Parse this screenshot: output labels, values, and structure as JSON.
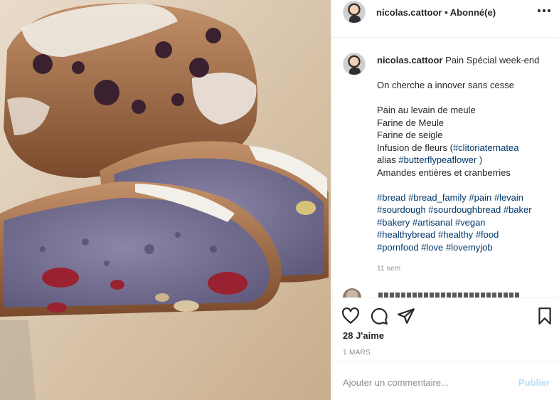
{
  "header": {
    "username": "nicolas.cattoor",
    "separator": " • ",
    "follow_status": "Abonné(e)"
  },
  "caption": {
    "username": "nicolas.cattoor",
    "title": "Pain Spécial week-end",
    "line1": "On cherche a innover sans cesse",
    "line2": "Pain au levain de meule",
    "line3": "Farine de Meule",
    "line4": "Farine de seigle",
    "line5_prefix": "Infusion de fleurs (",
    "line5_tag": "#clitoriaternatea",
    "line6_prefix": "alias ",
    "line6_tag": "#butterflypeaflower",
    "line6_suffix": " )",
    "line7": "Amandes entières et cranberries",
    "hashtags": [
      [
        "#bread",
        "#bread_family",
        "#pain",
        "#levain"
      ],
      [
        "#sourdough",
        "#sourdoughbread",
        "#baker"
      ],
      [
        "#bakery",
        "#artisanal",
        "#vegan"
      ],
      [
        "#healthybread",
        "#healthy",
        "#food"
      ],
      [
        "#pornfood",
        "#love",
        "#lovemyjob"
      ]
    ],
    "time_ago": "11 sem"
  },
  "actions": {
    "icons": [
      "heart-icon",
      "comment-icon",
      "share-icon",
      "bookmark-icon"
    ],
    "likes": "28 J'aime",
    "date": "1 MARS"
  },
  "comment_box": {
    "placeholder": "Ajouter un commentaire...",
    "publish_label": "Publier"
  },
  "colors": {
    "hashtag": "#00376b",
    "muted": "#8e8e8e",
    "publish_disabled": "#b2dffc",
    "bread_crumb": "#6d6a8c",
    "crust": "#9a6a45"
  }
}
